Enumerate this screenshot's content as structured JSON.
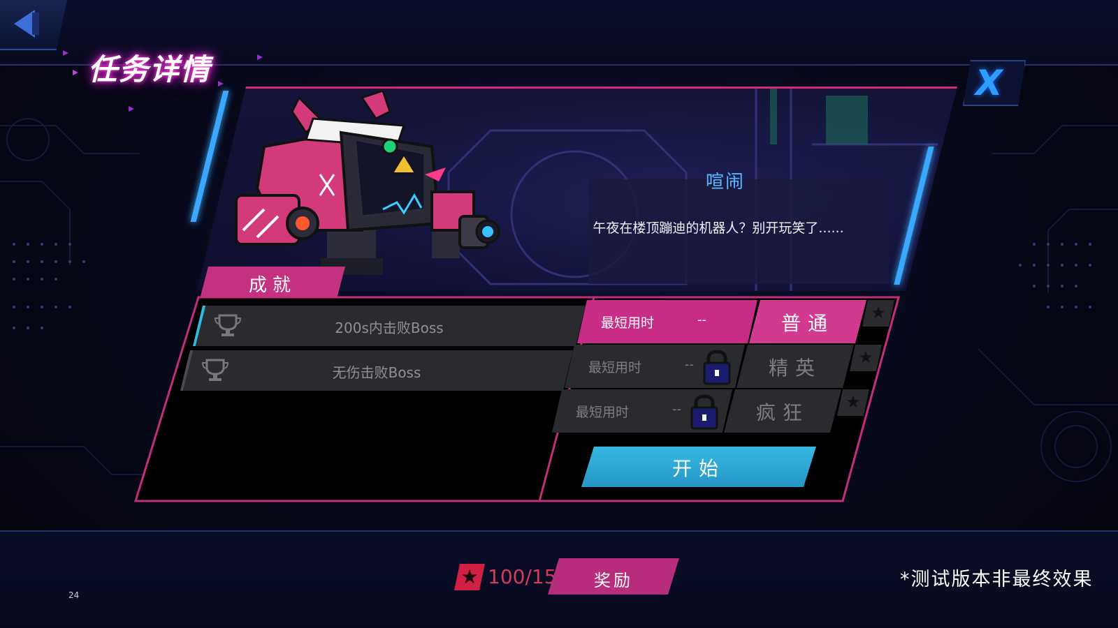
{
  "header": {
    "title": "任务详情",
    "close_glyph": "X"
  },
  "mission": {
    "boss_name": "喧闹",
    "description": "午夜在楼顶蹦迪的机器人？别开玩笑了......"
  },
  "achievements": {
    "tab_label": "成就",
    "items": [
      {
        "label": "200s内击败Boss"
      },
      {
        "label": "无伤击败Boss"
      }
    ]
  },
  "difficulties": [
    {
      "time_label": "最短用时",
      "time_value": "--",
      "name": "普通",
      "locked": false,
      "star_glyph": "★"
    },
    {
      "time_label": "最短用时",
      "time_value": "--",
      "name": "精英",
      "locked": true,
      "star_glyph": "★"
    },
    {
      "time_label": "最短用时",
      "time_value": "--",
      "name": "疯狂",
      "locked": true,
      "star_glyph": "★"
    }
  ],
  "start_button": {
    "label": "开始"
  },
  "footer": {
    "star_glyph": "★",
    "star_count": "100/15",
    "reward_label": "奖励",
    "watermark": "*测试版本非最终效果",
    "page_number": "24"
  },
  "colors": {
    "accent_pink": "#c72c86",
    "accent_blue": "#2e9dff",
    "start_blue": "#2596c7",
    "star_red": "#d22045"
  }
}
